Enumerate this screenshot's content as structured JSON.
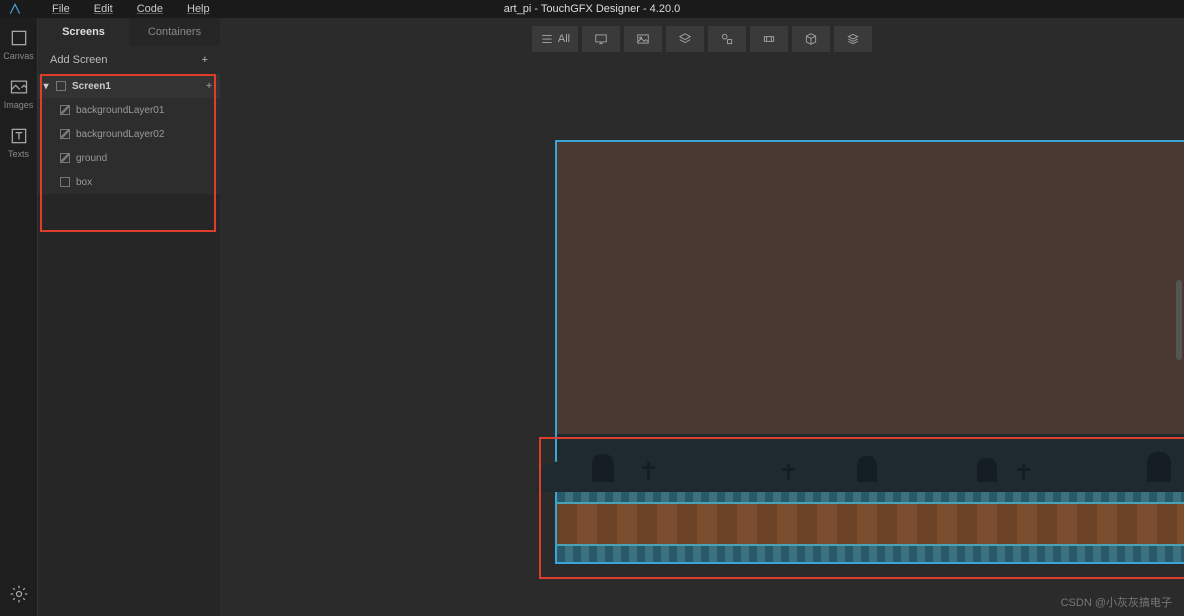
{
  "menu": {
    "file": "File",
    "edit": "Edit",
    "code": "Code",
    "help": "Help"
  },
  "title": "art_pi - TouchGFX Designer - 4.20.0",
  "leftbar": {
    "canvas": "Canvas",
    "images": "Images",
    "texts": "Texts"
  },
  "panel": {
    "tab_screens": "Screens",
    "tab_containers": "Containers",
    "add_screen": "Add Screen",
    "screen_name": "Screen1",
    "items": [
      {
        "label": "backgroundLayer01"
      },
      {
        "label": "backgroundLayer02"
      },
      {
        "label": "ground"
      },
      {
        "label": "box"
      }
    ]
  },
  "toolbar": {
    "all": "All"
  },
  "watermark": "CSDN @小灰灰搞电子"
}
